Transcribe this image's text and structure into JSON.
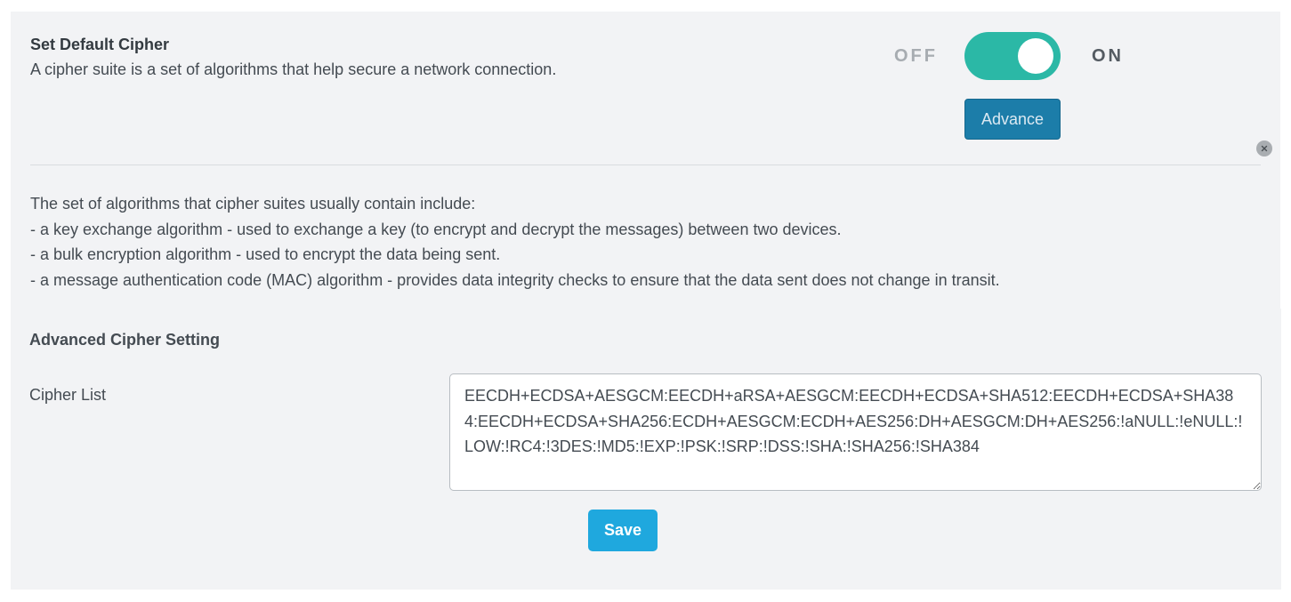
{
  "cipher_section": {
    "title": "Set Default Cipher",
    "subtitle": "A cipher suite is a set of algorithms that help secure a network connection.",
    "toggle": {
      "off_label": "OFF",
      "on_label": "ON",
      "state": "on"
    },
    "advance_label": "Advance",
    "close_icon": "close-icon",
    "description": [
      "The set of algorithms that cipher suites usually contain include:",
      "- a key exchange algorithm - used to exchange a key (to encrypt and decrypt the messages) between two devices.",
      "- a bulk encryption algorithm - used to encrypt the data being sent.",
      "- a message authentication code (MAC) algorithm - provides data integrity checks to ensure that the data sent does not change in transit."
    ]
  },
  "advanced_section": {
    "title": "Advanced Cipher Setting",
    "cipher_list_label": "Cipher List",
    "cipher_list_value": "EECDH+ECDSA+AESGCM:EECDH+aRSA+AESGCM:EECDH+ECDSA+SHA512:EECDH+ECDSA+SHA384:EECDH+ECDSA+SHA256:ECDH+AESGCM:ECDH+AES256:DH+AESGCM:DH+AES256:!aNULL:!eNULL:!LOW:!RC4:!3DES:!MD5:!EXP:!PSK:!SRP:!DSS:!SHA:!SHA256:!SHA384",
    "save_label": "Save"
  },
  "colors": {
    "panel_background": "#f2f3f5",
    "toggle_on": "#2bb8a6",
    "advance_button": "#1c7da9",
    "save_button": "#1fa8de"
  }
}
